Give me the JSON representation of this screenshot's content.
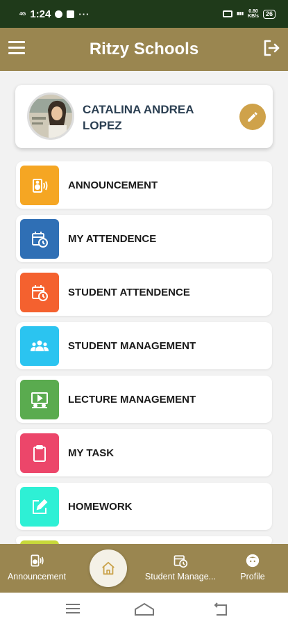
{
  "status_bar": {
    "network": "4G",
    "time": "1:24",
    "speed_value": "0.80",
    "speed_unit": "KB/s",
    "battery": "26"
  },
  "app_bar": {
    "title": "Ritzy Schools",
    "menu_icon": "hamburger-menu-icon",
    "logout_icon": "logout-icon"
  },
  "profile": {
    "name": "CATALINA ANDREA LOPEZ",
    "edit_icon": "pencil-icon"
  },
  "menu": {
    "items": [
      {
        "label": "ANNOUNCEMENT",
        "icon": "speaker-icon",
        "color": "#f5a623"
      },
      {
        "label": "MY ATTENDENCE",
        "icon": "calendar-clock-icon",
        "color": "#2f6fb5"
      },
      {
        "label": "STUDENT ATTENDENCE",
        "icon": "calendar-clock-icon",
        "color": "#f4612f"
      },
      {
        "label": "STUDENT MANAGEMENT",
        "icon": "group-icon",
        "color": "#2bc4f0"
      },
      {
        "label": "LECTURE MANAGEMENT",
        "icon": "presentation-icon",
        "color": "#5aab4f"
      },
      {
        "label": "MY TASK",
        "icon": "clipboard-icon",
        "color": "#ec466a"
      },
      {
        "label": "HOMEWORK",
        "icon": "edit-square-icon",
        "color": "#2ef0d5"
      }
    ],
    "partial_item_color": "#c8d83a"
  },
  "bottom_nav": {
    "items": [
      {
        "label": "Announcement",
        "icon": "speaker-icon"
      },
      {
        "label": "Student Manage...",
        "icon": "calendar-clock-icon"
      },
      {
        "label": "Profile",
        "icon": "profile-face-icon"
      }
    ],
    "home_icon": "home-icon"
  },
  "colors": {
    "brand": "#9a8650",
    "status_bar": "#1f3a1a",
    "accent": "#cfa24a"
  }
}
